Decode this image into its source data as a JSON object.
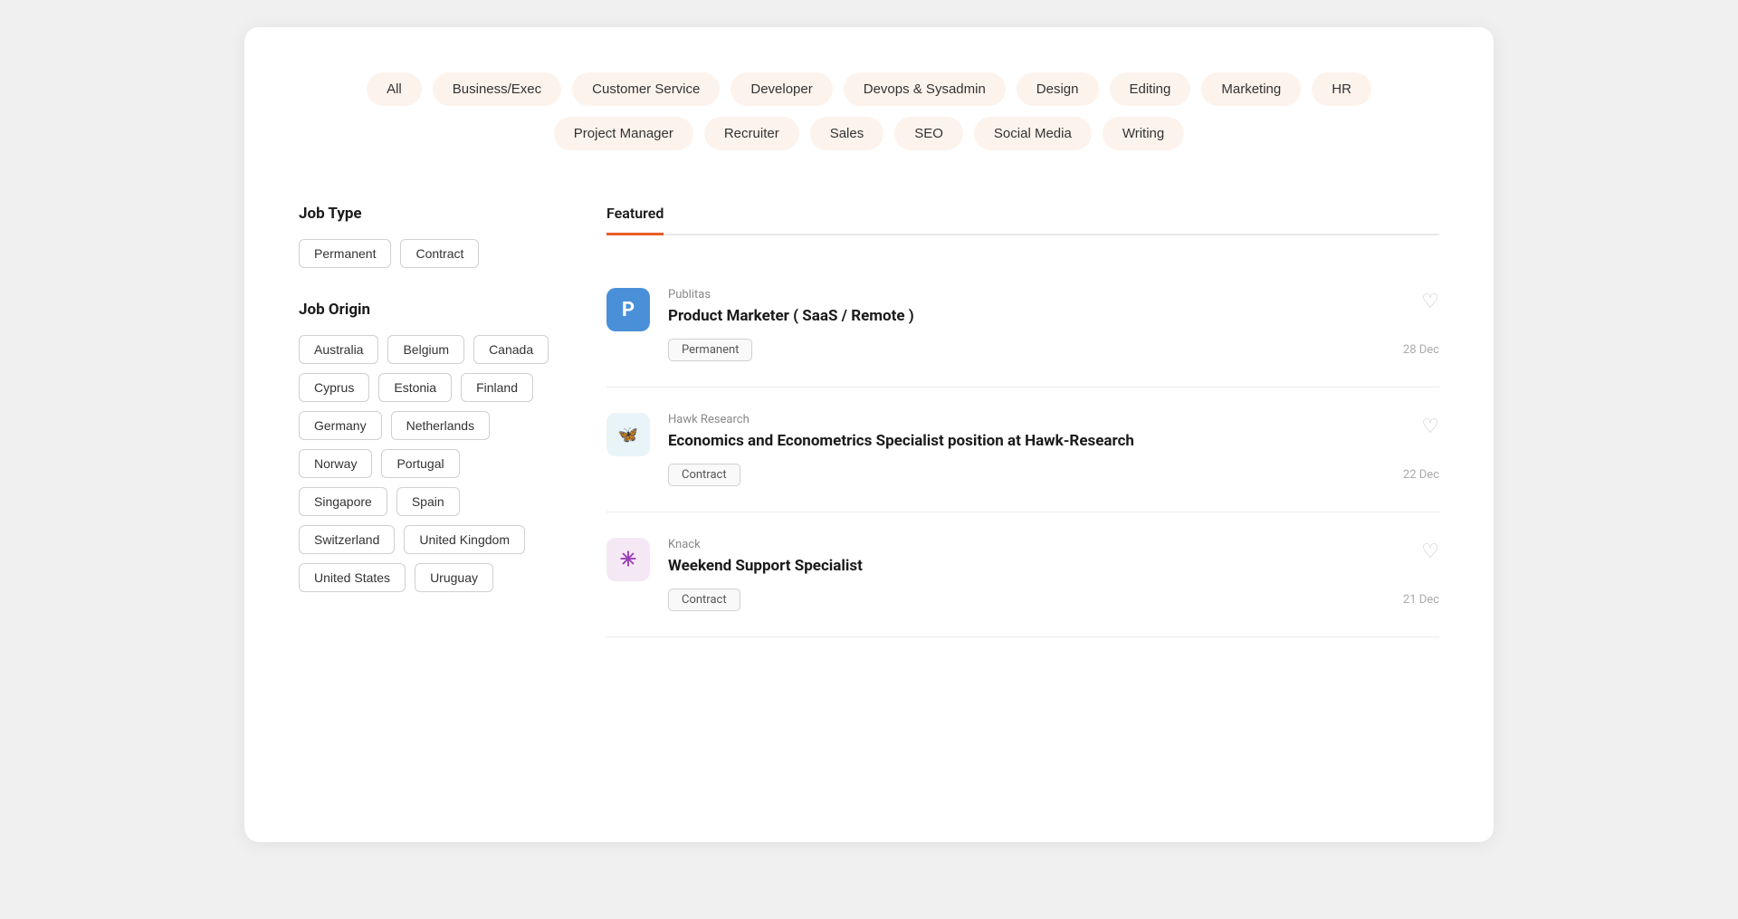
{
  "categories": [
    {
      "label": "All",
      "id": "all"
    },
    {
      "label": "Business/Exec",
      "id": "business-exec"
    },
    {
      "label": "Customer Service",
      "id": "customer-service"
    },
    {
      "label": "Developer",
      "id": "developer"
    },
    {
      "label": "Devops & Sysadmin",
      "id": "devops-sysadmin"
    },
    {
      "label": "Design",
      "id": "design"
    },
    {
      "label": "Editing",
      "id": "editing"
    },
    {
      "label": "Marketing",
      "id": "marketing"
    },
    {
      "label": "HR",
      "id": "hr"
    },
    {
      "label": "Project Manager",
      "id": "project-manager"
    },
    {
      "label": "Recruiter",
      "id": "recruiter"
    },
    {
      "label": "Sales",
      "id": "sales"
    },
    {
      "label": "SEO",
      "id": "seo"
    },
    {
      "label": "Social Media",
      "id": "social-media"
    },
    {
      "label": "Writing",
      "id": "writing"
    }
  ],
  "sidebar": {
    "jobTypeTitle": "Job Type",
    "jobTypes": [
      {
        "label": "Permanent"
      },
      {
        "label": "Contract"
      }
    ],
    "jobOriginTitle": "Job Origin",
    "jobOrigins": [
      {
        "label": "Australia"
      },
      {
        "label": "Belgium"
      },
      {
        "label": "Canada"
      },
      {
        "label": "Cyprus"
      },
      {
        "label": "Estonia"
      },
      {
        "label": "Finland"
      },
      {
        "label": "Germany"
      },
      {
        "label": "Netherlands"
      },
      {
        "label": "Norway"
      },
      {
        "label": "Portugal"
      },
      {
        "label": "Singapore"
      },
      {
        "label": "Spain"
      },
      {
        "label": "Switzerland"
      },
      {
        "label": "United Kingdom"
      },
      {
        "label": "United States"
      },
      {
        "label": "Uruguay"
      }
    ]
  },
  "featured": {
    "tabLabel": "Featured",
    "jobs": [
      {
        "id": "job-1",
        "company": "Publitas",
        "title": "Product Marketer ( SaaS / Remote )",
        "type": "Permanent",
        "date": "28 Dec",
        "logoType": "publitas",
        "logoText": "P"
      },
      {
        "id": "job-2",
        "company": "Hawk Research",
        "title": "Economics and Econometrics Specialist position at Hawk-Research",
        "type": "Contract",
        "date": "22 Dec",
        "logoType": "hawk",
        "logoText": "🦋"
      },
      {
        "id": "job-3",
        "company": "Knack",
        "title": "Weekend Support Specialist",
        "type": "Contract",
        "date": "21 Dec",
        "logoType": "knack",
        "logoText": "✳"
      }
    ]
  }
}
